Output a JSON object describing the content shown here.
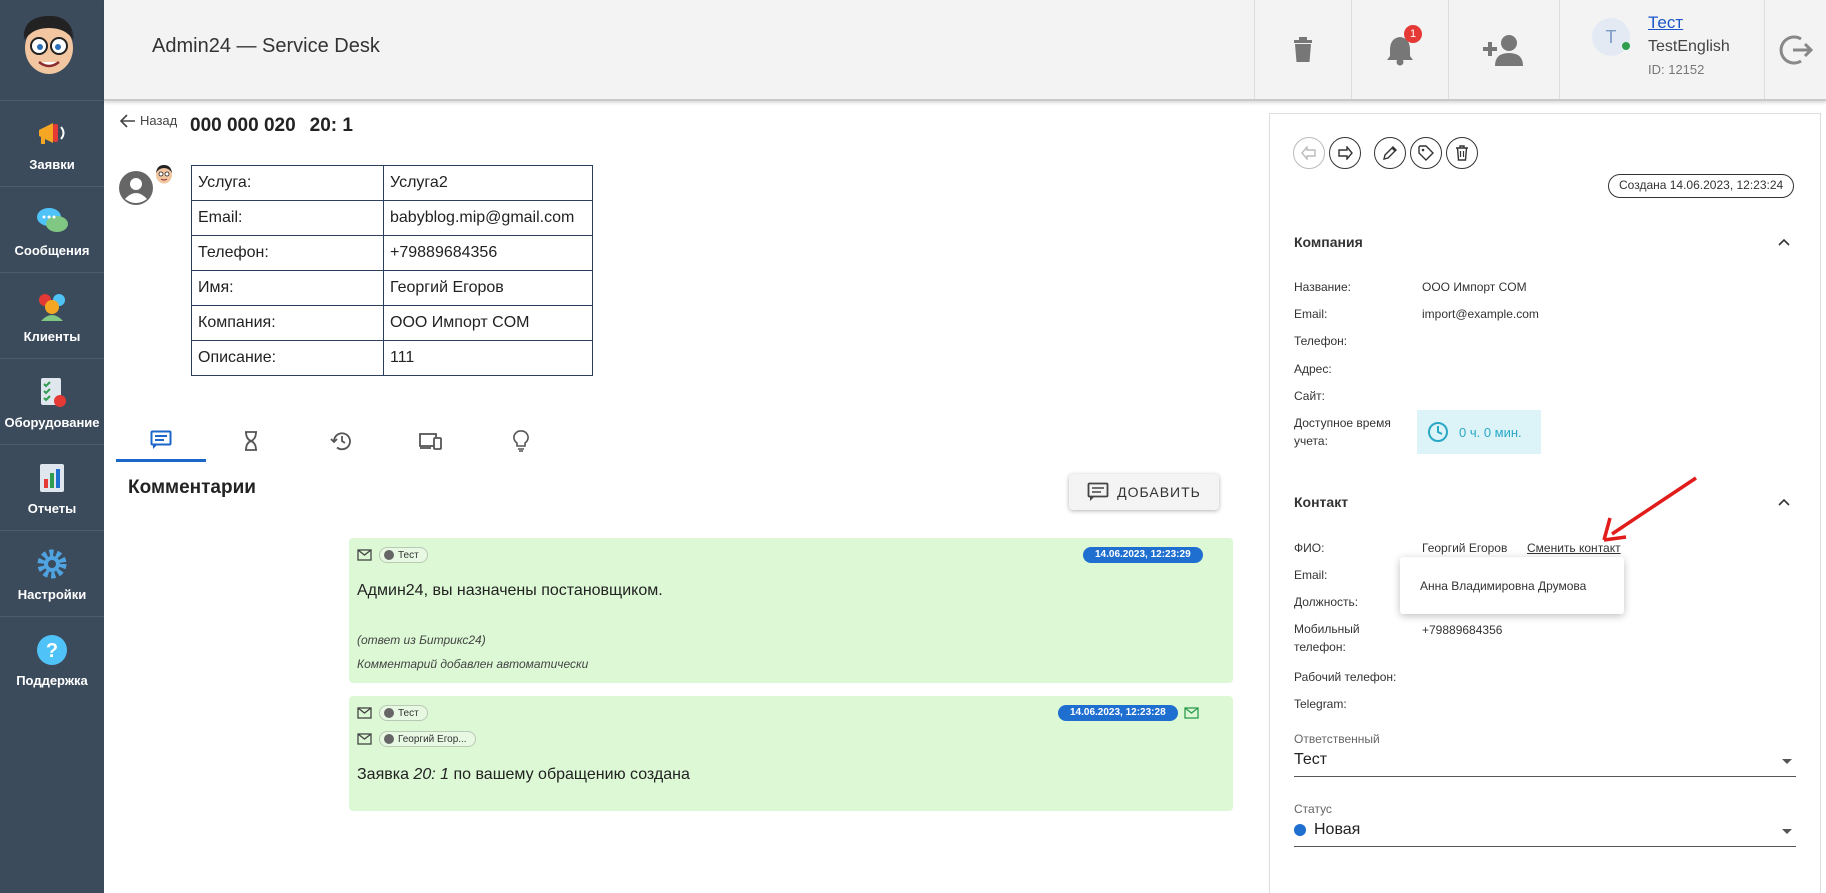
{
  "sidebar": {
    "items": [
      {
        "label": "Заявки"
      },
      {
        "label": "Сообщения"
      },
      {
        "label": "Клиенты"
      },
      {
        "label": "Оборудование"
      },
      {
        "label": "Отчеты"
      },
      {
        "label": "Настройки"
      },
      {
        "label": "Поддержка"
      }
    ]
  },
  "header": {
    "title": "Admin24 — Service Desk",
    "notifications_count": "1",
    "user": {
      "initial": "T",
      "name": "Тест",
      "login": "TestEnglish",
      "id": "ID: 12152"
    }
  },
  "ticket": {
    "back_label": "Назад",
    "number": "000 000 020",
    "short_id": "20: 1",
    "fields": [
      {
        "key": "Услуга:",
        "value": "Услуга2"
      },
      {
        "key": "Email:",
        "value": "babyblog.mip@gmail.com"
      },
      {
        "key": "Телефон:",
        "value": "+79889684356"
      },
      {
        "key": "Имя:",
        "value": "Георгий Егоров"
      },
      {
        "key": "Компания:",
        "value": "ООО Импорт COM"
      },
      {
        "key": "Описание:",
        "value": "111"
      }
    ]
  },
  "comments": {
    "title": "Комментарии",
    "add_label": "ДОБАВИТЬ",
    "items": [
      {
        "author": "Тест",
        "date": "14.06.2023, 12:23:29",
        "text": "Админ24, вы назначены постановщиком.",
        "note1": "(ответ из Битрикс24)",
        "note2": "Комментарий добавлен автоматически"
      },
      {
        "author": "Тест",
        "author2": "Георгий Егор...",
        "date": "14.06.2023, 12:23:28",
        "text_prefix": "Заявка ",
        "text_italic": "20: 1",
        "text_suffix": " по вашему обращению создана"
      }
    ]
  },
  "panel": {
    "created": "Создана 14.06.2023, 12:23:24",
    "company": {
      "title": "Компания",
      "name_label": "Название:",
      "name": "ООО Импорт COM",
      "email_label": "Email:",
      "email": "import@example.com",
      "phone_label": "Телефон:",
      "address_label": "Адрес:",
      "site_label": "Сайт:",
      "time_label": "Доступное время учета:",
      "time_value": "0 ч. 0 мин."
    },
    "contact": {
      "title": "Контакт",
      "fio_label": "ФИО:",
      "fio": "Георгий Егоров",
      "change_label": "Сменить контакт",
      "dropdown_item": "Анна Владимировна Друмова",
      "email_label": "Email:",
      "position_label": "Должность:",
      "mobile_label": "Мобильный телефон:",
      "mobile": "+79889684356",
      "work_phone_label": "Рабочий телефон:",
      "telegram_label": "Telegram:"
    },
    "responsible_label": "Ответственный",
    "responsible": "Тест",
    "status_label": "Статус",
    "status": "Новая"
  }
}
